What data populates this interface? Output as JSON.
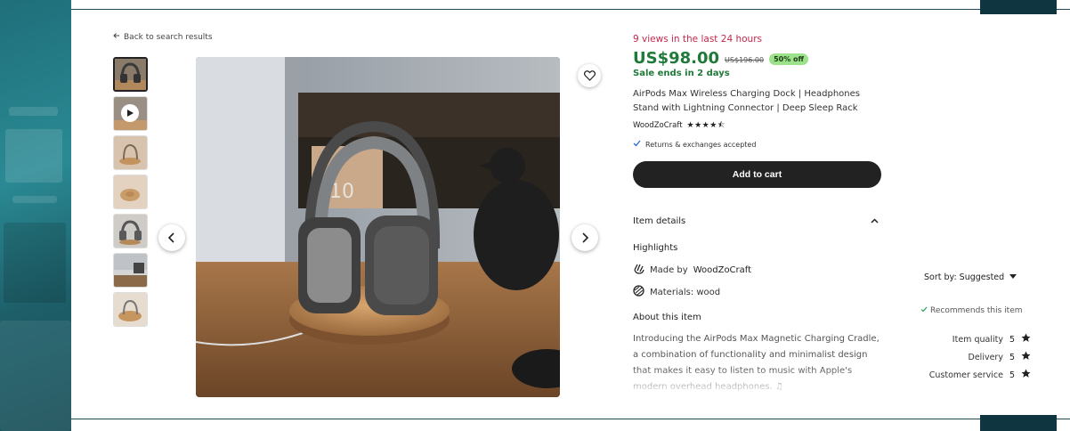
{
  "listing": {
    "back_label": "Back to search results",
    "views": "9 views in the last 24 hours",
    "price": "US$98.00",
    "original_price": "US$196.00",
    "discount": "50% off",
    "sale_ends": "Sale ends in 2 days",
    "title": "AirPods Max Wireless Charging Dock | Headphones Stand with Lightning Connector | Deep Sleep Rack",
    "seller": "WoodZoCraft",
    "seller_stars": "★★★★⯪",
    "returns": "Returns & exchanges accepted",
    "add_to_cart": "Add to cart"
  },
  "details": {
    "section_title": "Item details",
    "highlights_title": "Highlights",
    "made_by_prefix": "Made by",
    "made_by_seller": "WoodZoCraft",
    "materials": "Materials: wood",
    "about_title": "About this item",
    "description": "Introducing the AirPods Max Magnetic Charging Cradle, a combination of functionality and minimalist design that makes it easy to listen to music with Apple's modern overhead headphones. ♫"
  },
  "reviews": {
    "sort_label": "Sort by: Suggested",
    "recommends": "Recommends this item",
    "ratings": [
      {
        "label": "Item quality",
        "value": "5"
      },
      {
        "label": "Delivery",
        "value": "5"
      },
      {
        "label": "Customer service",
        "value": "5"
      }
    ]
  },
  "colors": {
    "price_green": "#1f7a3a",
    "views_red": "#c3274a",
    "badge_green": "#9be28b",
    "button_dark": "#222222",
    "teal_frame": "#1f6f7a"
  },
  "icons": {
    "back": "arrow-left-icon",
    "play": "play-icon",
    "favorite": "heart-icon",
    "prev": "chevron-left-icon",
    "next": "chevron-right-icon",
    "check": "check-icon",
    "collapse": "chevron-up-icon",
    "made_by": "hand-icon",
    "materials": "materials-icon",
    "sort": "caret-down-icon",
    "rating": "star-icon"
  }
}
